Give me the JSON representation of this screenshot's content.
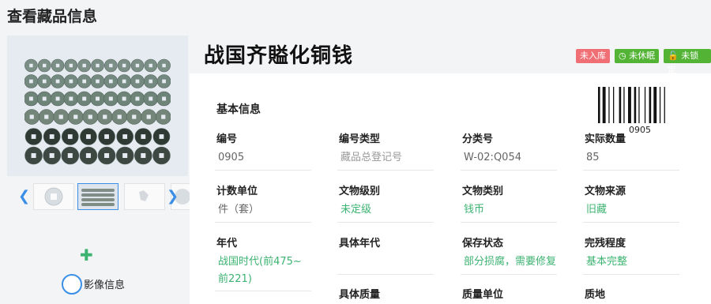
{
  "page_title": "查看藏品信息",
  "item": {
    "title": "战国齐賹化铜钱",
    "badges": [
      {
        "label": "未入库",
        "color": "#f06f75",
        "icon": ""
      },
      {
        "label": "未休眠",
        "color": "#52b335",
        "icon": "clock-icon"
      },
      {
        "label": "未锁定",
        "color": "#52b335",
        "icon": "lock-icon"
      }
    ],
    "barcode_number": "0905"
  },
  "section_title": "基本信息",
  "fields": {
    "code": {
      "label": "编号",
      "value": "0905"
    },
    "code_type": {
      "label": "编号类型",
      "value": "藏品总登记号"
    },
    "category_no": {
      "label": "分类号",
      "value": "W-02:Q054"
    },
    "actual_qty": {
      "label": "实际数量",
      "value": "85"
    },
    "unit": {
      "label": "计数单位",
      "value": "件（套）"
    },
    "grade": {
      "label": "文物级别",
      "value": "未定级"
    },
    "relic_type": {
      "label": "文物类别",
      "value": "钱币"
    },
    "source": {
      "label": "文物来源",
      "value": "旧藏"
    },
    "era": {
      "label": "年代",
      "value": "战国时代(前475~前221)"
    },
    "specific_era": {
      "label": "具体年代",
      "value": ""
    },
    "condition": {
      "label": "保存状态",
      "value": "部分损腐，需要修复"
    },
    "completeness": {
      "label": "完残程度",
      "value": "基本完整"
    },
    "specific_mass": {
      "label": "具体质量",
      "value": ""
    },
    "mass_unit": {
      "label": "质量单位",
      "value": ""
    },
    "texture": {
      "label": "质地",
      "value": ""
    }
  },
  "sidebar": {
    "media_label": "影像信息"
  },
  "colors": {
    "accent_blue": "#3a8ee6",
    "green": "#3cb371",
    "red_badge": "#f06f75",
    "green_badge": "#52b335"
  }
}
